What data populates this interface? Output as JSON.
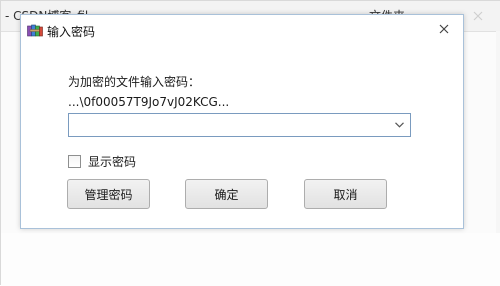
{
  "background_window": {
    "title_left": "- CSDN博客_fil...",
    "title_right": "文件夹"
  },
  "dialog": {
    "title": "输入密码",
    "prompt": "为加密的文件输入密码：",
    "filename": "...\\0f00057T9Jo7vJ02KCG...",
    "password_value": "",
    "show_password_label": "显示密码",
    "show_password_checked": false,
    "buttons": {
      "manage": "管理密码",
      "ok": "确定",
      "cancel": "取消"
    }
  },
  "icons": {
    "app": "winrar-books-icon",
    "close": "close-icon",
    "dropdown": "chevron-down-icon"
  }
}
